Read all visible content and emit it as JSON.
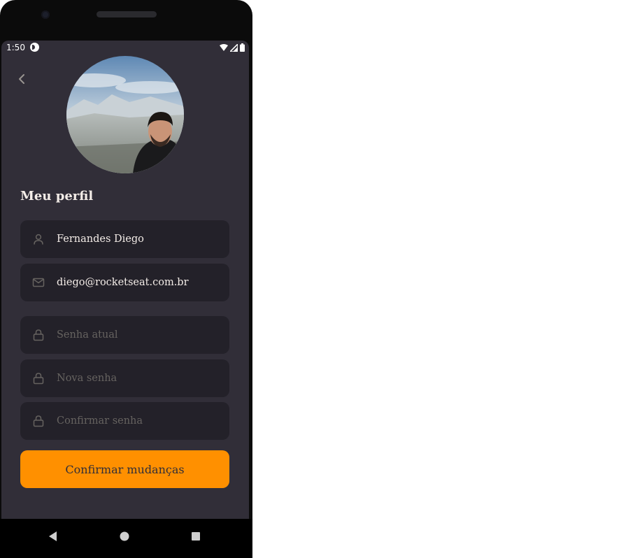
{
  "status_bar": {
    "time": "1:50"
  },
  "profile": {
    "title": "Meu perfil",
    "name_value": "Fernandes Diego",
    "email_value": "diego@rocketseat.com.br",
    "current_password_placeholder": "Senha atual",
    "new_password_placeholder": "Nova senha",
    "confirm_password_placeholder": "Confirmar senha",
    "submit_label": "Confirmar mudanças"
  },
  "icons": {
    "back": "chevron-left-icon",
    "name_field": "user-icon",
    "email_field": "mail-icon",
    "password_fields": "lock-icon",
    "nav_back": "triangle-back-icon",
    "nav_home": "circle-home-icon",
    "nav_recents": "square-recents-icon"
  },
  "colors": {
    "background": "#312e38",
    "input_background": "#232129",
    "accent": "#ff9000",
    "text": "#f4ede8",
    "placeholder": "#666360"
  }
}
